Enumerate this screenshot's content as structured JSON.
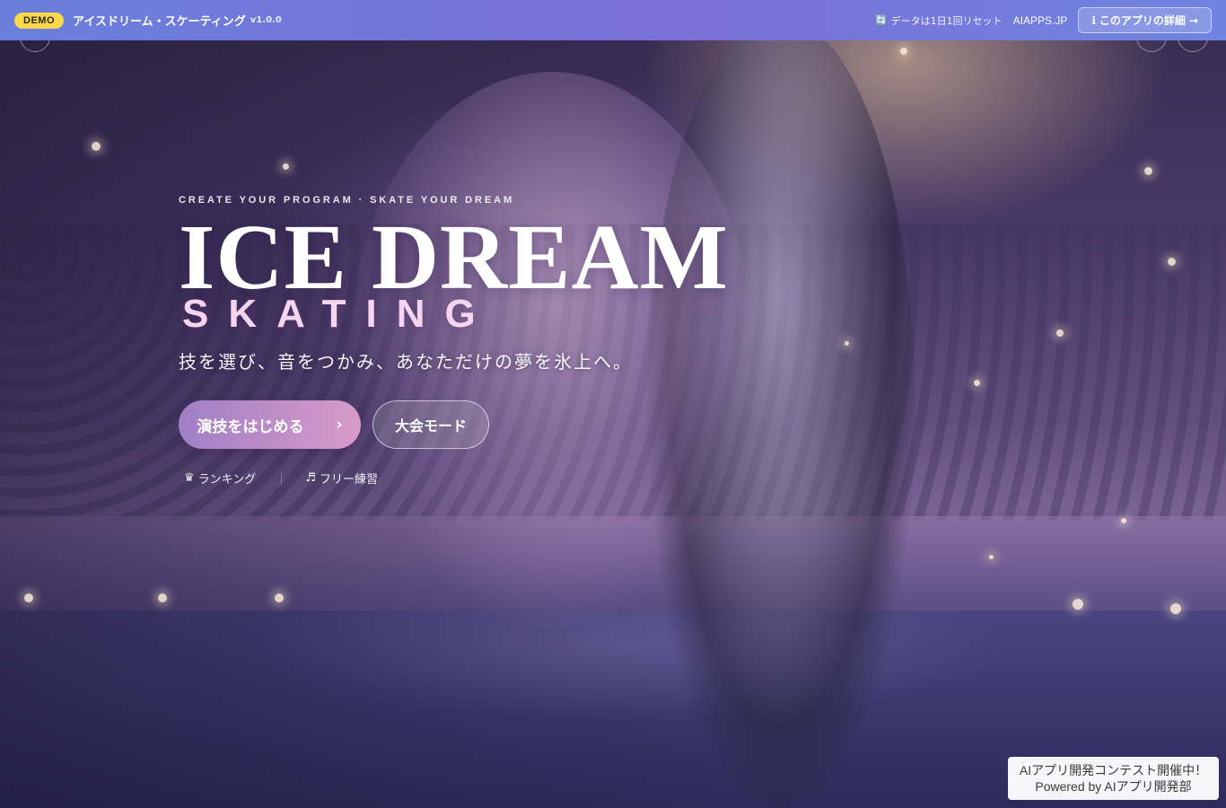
{
  "topbar": {
    "demo_badge": "DEMO",
    "app_title": "アイスドリーム・スケーティング",
    "version": "v1.0.0",
    "reset_icon": "🔄",
    "reset_note": "データは1日1回リセット",
    "site_link": "AIAPPS.JP",
    "detail_icon": "ℹ",
    "detail_label": "このアプリの詳細",
    "detail_arrow": "→"
  },
  "hero": {
    "tagline": "CREATE YOUR PROGRAM · SKATE YOUR DREAM",
    "title_main": "ICE DREAM",
    "title_sub": "SKATING",
    "subtitle": "技を選び、音をつかみ、あなただけの夢を氷上へ。",
    "start_button": {
      "label": "演技をはじめる",
      "arrow": "›"
    },
    "tournament_button": {
      "label": "大会モード"
    },
    "links": [
      {
        "icon": "♛",
        "label": "ランキング"
      },
      {
        "icon": "♬",
        "label": "フリー練習"
      }
    ],
    "separator": "｜"
  },
  "promo": {
    "line1": "AIアプリ開発コンテスト開催中！",
    "line2": "Powered by AIアプリ開発部"
  },
  "colors": {
    "topbar_start": "#6a7fdc",
    "topbar_end": "#6e84e0",
    "demo_badge": "#f9d94a",
    "title_sub": "#f4d4ee",
    "button_start_from": "#a07fc6",
    "button_start_to": "#d89bc8"
  }
}
